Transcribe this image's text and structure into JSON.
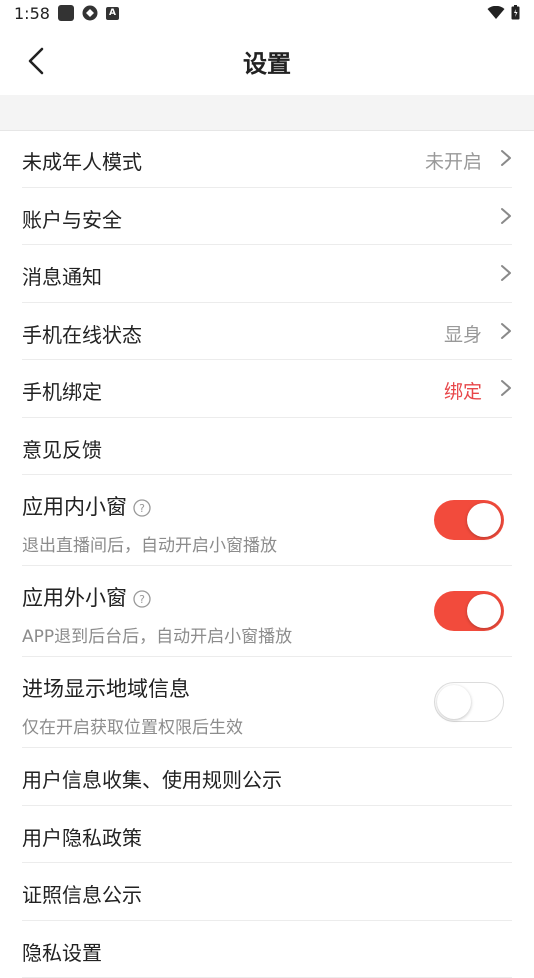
{
  "status_bar": {
    "time": "1:58"
  },
  "header": {
    "title": "设置"
  },
  "rows": [
    {
      "label": "未成年人模式",
      "value": "未开启"
    },
    {
      "label": "账户与安全"
    },
    {
      "label": "消息通知"
    },
    {
      "label": "手机在线状态",
      "value": "显身"
    },
    {
      "label": "手机绑定",
      "value": "绑定"
    },
    {
      "label": "意见反馈"
    }
  ],
  "toggles": [
    {
      "label": "应用内小窗",
      "sub": "退出直播间后，自动开启小窗播放",
      "state": "on"
    },
    {
      "label": "应用外小窗",
      "sub": "APP退到后台后，自动开启小窗播放",
      "state": "on"
    },
    {
      "label": "进场显示地域信息",
      "sub": "仅在开启获取位置权限后生效",
      "state": "off"
    }
  ],
  "links": [
    {
      "label": "用户信息收集、使用规则公示"
    },
    {
      "label": "用户隐私政策"
    },
    {
      "label": "证照信息公示"
    },
    {
      "label": "隐私设置"
    }
  ],
  "colors": {
    "accent": "#f24b3c",
    "value_red": "#e8474a",
    "muted": "#999999"
  }
}
